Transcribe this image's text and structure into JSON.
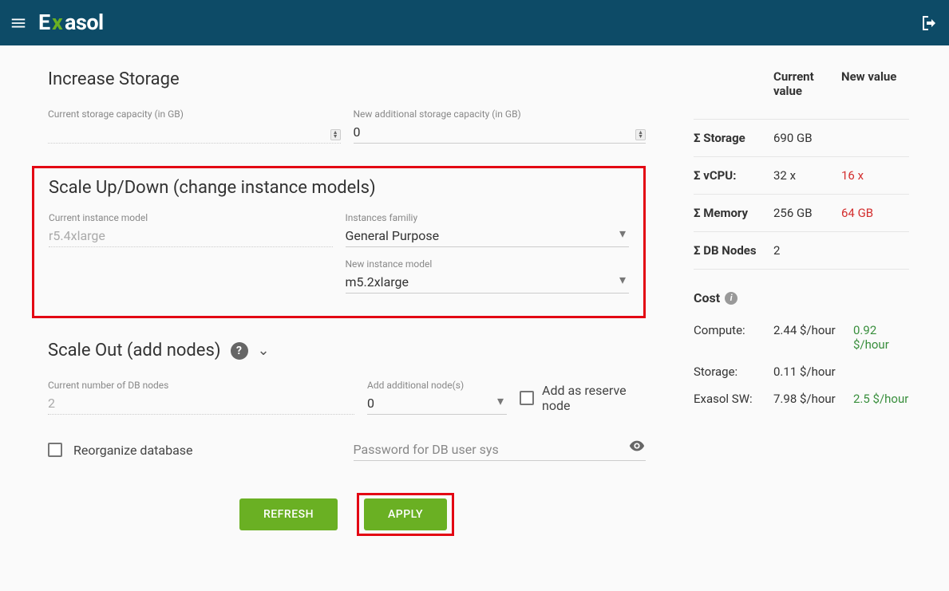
{
  "header": {
    "logo_text": "Exasol"
  },
  "storage": {
    "title": "Increase Storage",
    "current_label": "Current storage capacity (in GB)",
    "current_value": "",
    "new_label": "New additional storage capacity (in GB)",
    "new_value": "0"
  },
  "scale": {
    "title": "Scale Up/Down (change instance models)",
    "current_model_label": "Current instance model",
    "current_model": "r5.4xlarge",
    "family_label": "Instances familiy",
    "family_value": "General Purpose",
    "new_model_label": "New instance model",
    "new_model": "m5.2xlarge"
  },
  "scaleout": {
    "title": "Scale Out (add nodes)",
    "current_nodes_label": "Current number of DB nodes",
    "current_nodes": "2",
    "add_nodes_label": "Add additional node(s)",
    "add_nodes_value": "0",
    "reserve_label": "Add as reserve node",
    "reorganize_label": "Reorganize database",
    "password_placeholder": "Password for DB user sys"
  },
  "buttons": {
    "refresh": "Refresh",
    "apply": "Apply"
  },
  "summary": {
    "header_current": "Current value",
    "header_new": "New value",
    "rows": [
      {
        "label": "Σ Storage",
        "current": "690 GB",
        "new": "",
        "color": ""
      },
      {
        "label": "Σ vCPU:",
        "current": "32 x",
        "new": "16 x",
        "color": "red"
      },
      {
        "label": "Σ Memory",
        "current": "256 GB",
        "new": "64 GB",
        "color": "red"
      },
      {
        "label": "Σ DB Nodes",
        "current": "2",
        "new": "",
        "color": ""
      }
    ],
    "cost_title": "Cost",
    "costs": [
      {
        "label": "Compute:",
        "current": "2.44 $/hour",
        "new": "0.92 $/hour",
        "color": "green"
      },
      {
        "label": "Storage:",
        "current": "0.11 $/hour",
        "new": "",
        "color": ""
      },
      {
        "label": "Exasol SW:",
        "current": "7.98 $/hour",
        "new": "2.5 $/hour",
        "color": "green"
      }
    ]
  }
}
